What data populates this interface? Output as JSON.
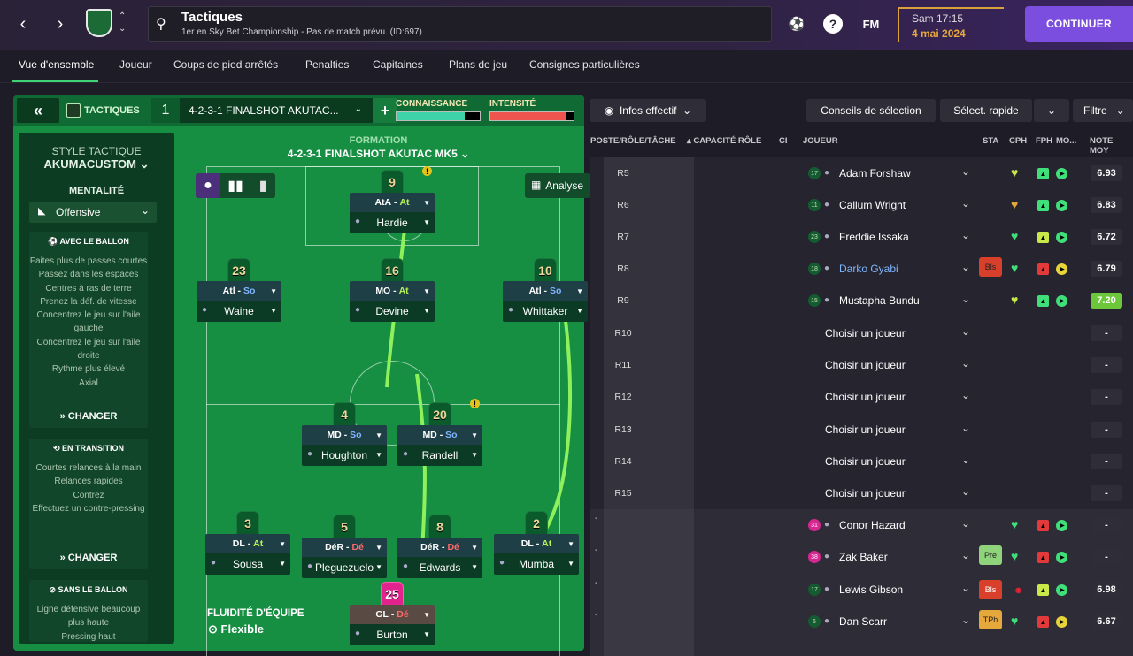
{
  "header": {
    "title": "Tactiques",
    "subtitle": "1er en Sky Bet Championship - Pas de match prévu. (ID:697)",
    "time": "Sam 17:15",
    "date": "4 mai 2024",
    "continue_label": "CONTINUER",
    "fm_label": "FM",
    "help_label": "?"
  },
  "subnav": {
    "tabs": [
      "Vue d'ensemble",
      "Joueur",
      "Coups de pied arrêtés",
      "Penalties",
      "Capitaines",
      "Plans de jeu",
      "Consignes particulières"
    ]
  },
  "tactics": {
    "back_label": "«",
    "label": "TACTIQUES",
    "slot": "1",
    "formation_selected": "4-2-3-1 FINALSHOT AKUTAC...",
    "familiarity_label": "CONNAISSANCE",
    "intensity_label": "INTENSITÉ",
    "familiarity_level": 0.82,
    "intensity_level": 0.92,
    "style_heading": "STYLE TACTIQUE",
    "style_name": "AKUMACUSTOM",
    "mentality_heading": "MENTALITÉ",
    "mentality_value": "Offensive",
    "in_possession": {
      "title": "AVEC LE BALLON",
      "items": [
        "Faites plus de passes courtes",
        "Passez dans les espaces",
        "Centres à ras de terre",
        "Prenez la déf. de vitesse",
        "Concentrez le jeu sur l'aile gauche",
        "Concentrez le jeu sur l'aile droite",
        "Rythme plus élevé",
        "Axial"
      ],
      "change_label": "CHANGER"
    },
    "in_transition": {
      "title": "EN TRANSITION",
      "items": [
        "Courtes relances à la main",
        "Relances rapides",
        "Contrez",
        "Effectuez un contre-pressing"
      ],
      "change_label": "CHANGER"
    },
    "out_of_possession": {
      "title": "SANS LE BALLON",
      "items": [
        "Ligne défensive beaucoup plus haute",
        "Pressing haut"
      ]
    },
    "formation_heading": "FORMATION",
    "formation_name": "4-2-3-1 FINALSHOT AKUTAC MK5",
    "analyse_label": "Analyse",
    "fluidity_heading": "FLUIDITÉ D'ÉQUIPE",
    "fluidity_value": "Flexible"
  },
  "pitch_players": [
    {
      "num": "9",
      "role": "AtA",
      "duty": "At",
      "name": "Hardie",
      "warn": true
    },
    {
      "num": "23",
      "role": "Atl",
      "duty": "So",
      "name": "Waine"
    },
    {
      "num": "16",
      "role": "MO",
      "duty": "At",
      "name": "Devine"
    },
    {
      "num": "10",
      "role": "Atl",
      "duty": "So",
      "name": "Whittaker"
    },
    {
      "num": "4",
      "role": "MD",
      "duty": "So",
      "name": "Houghton"
    },
    {
      "num": "20",
      "role": "MD",
      "duty": "So",
      "name": "Randell",
      "warn": true
    },
    {
      "num": "3",
      "role": "DL",
      "duty": "At",
      "name": "Sousa"
    },
    {
      "num": "5",
      "role": "DéR",
      "duty": "Dé",
      "name": "Pleguezuelo"
    },
    {
      "num": "8",
      "role": "DéR",
      "duty": "Dé",
      "name": "Edwards"
    },
    {
      "num": "2",
      "role": "DL",
      "duty": "At",
      "name": "Mumba"
    },
    {
      "num": "25",
      "role": "GL",
      "duty": "Dé",
      "name": "Burton"
    }
  ],
  "squad": {
    "info_label": "Infos effectif",
    "advice_label": "Conseils de sélection",
    "quick_label": "Sélect. rapide",
    "filter_label": "Filtre",
    "columns": [
      "POSTE/RÔLE/TÂCHE",
      "CAPACITÉ RÔLE",
      "CI",
      "JOUEUR",
      "STA",
      "CPH",
      "FPH",
      "MO...",
      "NOTE MOY"
    ],
    "rows": [
      {
        "pos": "R5",
        "num": "17",
        "name": "Adam Forshaw",
        "rating": "6.93"
      },
      {
        "pos": "R6",
        "num": "11",
        "name": "Callum Wright",
        "rating": "6.83"
      },
      {
        "pos": "R7",
        "num": "23",
        "name": "Freddie Issaka",
        "rating": "6.72"
      },
      {
        "pos": "R8",
        "num": "18",
        "name": "Darko Gyabi",
        "rating": "6.79",
        "badge": "Bls",
        "highlight": true
      },
      {
        "pos": "R9",
        "num": "15",
        "name": "Mustapha Bundu",
        "rating": "7.20",
        "best": true
      },
      {
        "pos": "R10",
        "name": "Choisir un joueur",
        "rating": "-"
      },
      {
        "pos": "R11",
        "name": "Choisir un joueur",
        "rating": "-"
      },
      {
        "pos": "R12",
        "name": "Choisir un joueur",
        "rating": "-"
      },
      {
        "pos": "R13",
        "name": "Choisir un joueur",
        "rating": "-"
      },
      {
        "pos": "R14",
        "name": "Choisir un joueur",
        "rating": "-"
      },
      {
        "pos": "R15",
        "name": "Choisir un joueur",
        "rating": "-"
      },
      {
        "pos": "-",
        "num": "31",
        "name": "Conor Hazard",
        "rating": "-",
        "pink": true
      },
      {
        "pos": "-",
        "num": "38",
        "name": "Zak Baker",
        "rating": "-",
        "pink": true,
        "badge": "Pre"
      },
      {
        "pos": "-",
        "num": "17",
        "name": "Lewis Gibson",
        "rating": "6.98",
        "badge": "Bls"
      },
      {
        "pos": "-",
        "num": "6",
        "name": "Dan Scarr",
        "rating": "6.67",
        "badge": "TPh"
      }
    ]
  },
  "colors": {
    "accent": "#3ed373",
    "continue": "#7b4ee0",
    "pitch": "#178f43",
    "date": "#e9a93a"
  }
}
